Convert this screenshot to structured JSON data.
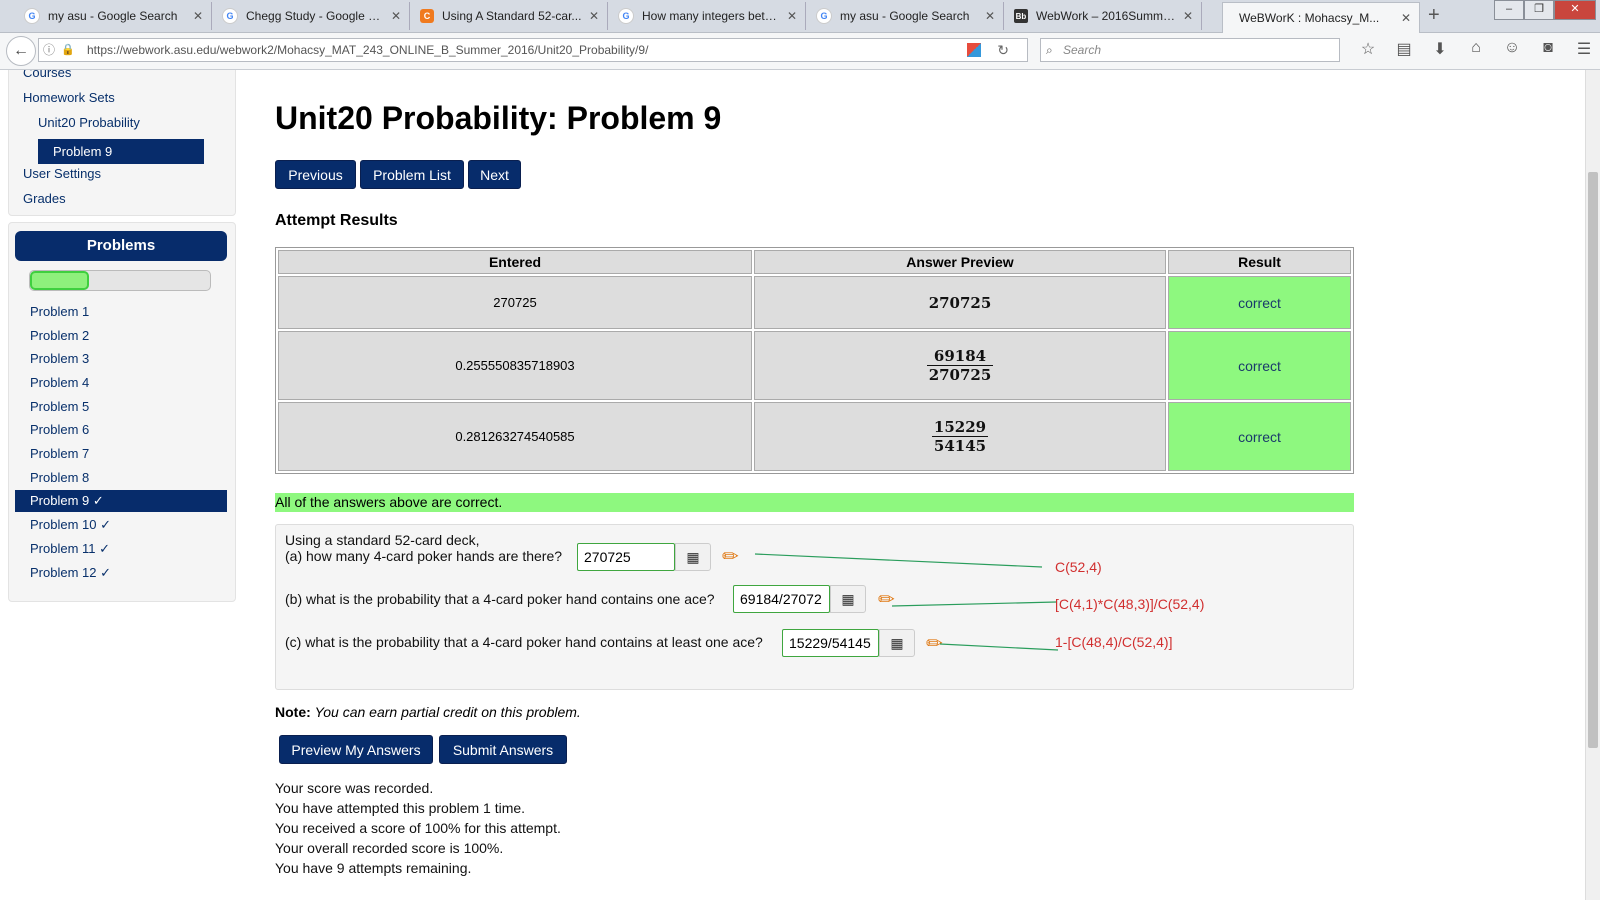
{
  "browser": {
    "tabs": [
      {
        "label": "my asu - Google Search",
        "icon": "G"
      },
      {
        "label": "Chegg Study - Google Se...",
        "icon": "G"
      },
      {
        "label": "Using A Standard 52-car...",
        "icon": "C"
      },
      {
        "label": "How many integers betw...",
        "icon": "G"
      },
      {
        "label": "my asu - Google Search",
        "icon": "G"
      },
      {
        "label": "WebWork – 2016Summer...",
        "icon": "Bb"
      },
      {
        "label": "WeBWorK : Mohacsy_M...",
        "icon": ""
      }
    ],
    "url": "https://webwork.asu.edu/webwork2/Mohacsy_MAT_243_ONLINE_B_Summer_2016/Unit20_Probability/9/",
    "search_placeholder": "Search"
  },
  "sidebar": {
    "nav": [
      "Courses",
      "Homework Sets",
      "Unit20 Probability",
      "Problem 9",
      "User Settings",
      "Grades"
    ],
    "problems_header": "Problems",
    "progress_fraction": 0.33,
    "problems": [
      "Problem 1",
      "Problem 2",
      "Problem 3",
      "Problem 4",
      "Problem 5",
      "Problem 6",
      "Problem 7",
      "Problem 8",
      "Problem 9 ✓",
      "Problem 10 ✓",
      "Problem 11 ✓",
      "Problem 12 ✓"
    ]
  },
  "main": {
    "title": "Unit20 Probability: Problem 9",
    "nav_buttons": {
      "previous": "Previous",
      "list": "Problem List",
      "next": "Next"
    },
    "section": "Attempt Results",
    "table": {
      "headers": [
        "Entered",
        "Answer Preview",
        "Result"
      ],
      "rows": [
        {
          "entered": "270725",
          "preview_num": "270725",
          "preview_den": "",
          "result": "correct"
        },
        {
          "entered": "0.255550835718903",
          "preview_num": "69184",
          "preview_den": "270725",
          "result": "correct"
        },
        {
          "entered": "0.281263274540585",
          "preview_num": "15229",
          "preview_den": "54145",
          "result": "correct"
        }
      ]
    },
    "all_correct": "All of the answers above are correct.",
    "problem": {
      "intro": "Using a standard 52-card deck,",
      "a": {
        "question": "(a) how many 4-card poker hands are there?",
        "answer": "270725",
        "annotation": "C(52,4)"
      },
      "b": {
        "question": "(b) what is the probability that a 4-card poker hand contains one ace?",
        "answer": "69184/27072",
        "annotation": "[C(4,1)*C(48,3)]/C(52,4)"
      },
      "c": {
        "question": "(c) what is the probability that a 4-card poker hand contains at least one ace?",
        "answer": "15229/54145",
        "annotation": "1-[C(48,4)/C(52,4)]"
      }
    },
    "note_label": "Note:",
    "note_text": "You can earn partial credit on this problem.",
    "buttons": {
      "preview": "Preview My Answers",
      "submit": "Submit Answers"
    },
    "status": [
      "Your score was recorded.",
      "You have attempted this problem 1 time.",
      "You received a score of 100% for this attempt.",
      "Your overall recorded score is 100%.",
      "You have 9 attempts remaining."
    ]
  }
}
